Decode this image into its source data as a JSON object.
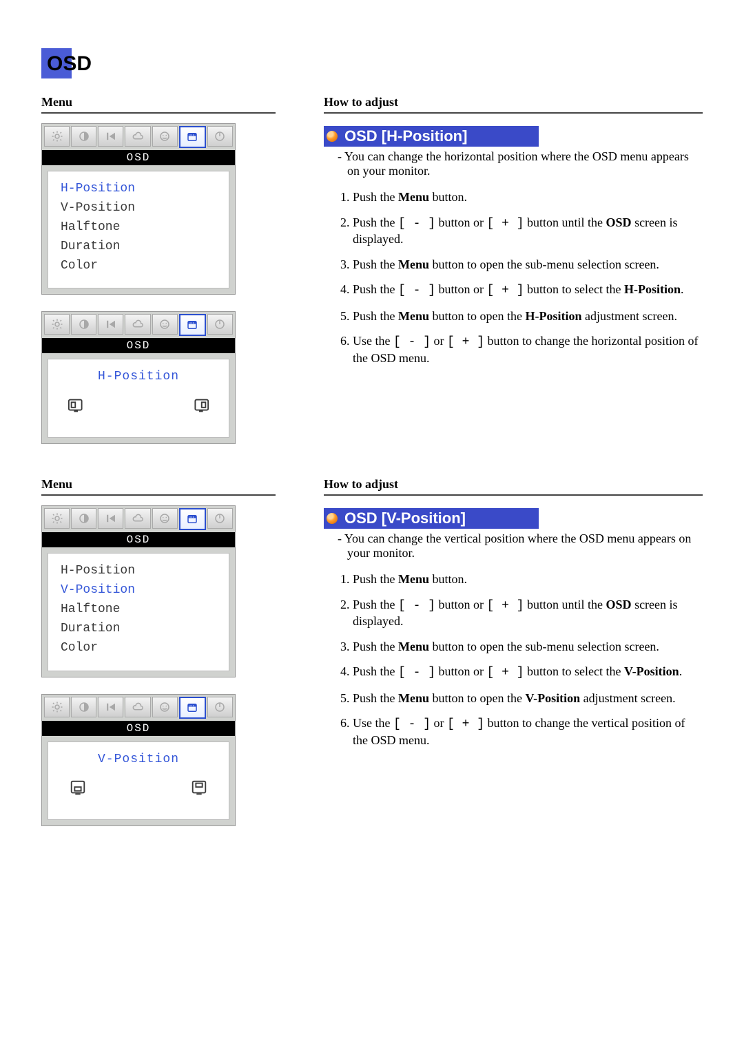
{
  "title": "OSD",
  "columns": {
    "left": "Menu",
    "right": "How to adjust"
  },
  "osd_menu": {
    "header_label": "OSD",
    "items": [
      "H-Position",
      "V-Position",
      "Halftone",
      "Duration",
      "Color"
    ]
  },
  "sections": [
    {
      "heading": "OSD [H-Position]",
      "sub_label": "H-Position",
      "selected_index": 0,
      "desc": "- You can change the horizontal position where the OSD menu appears on your monitor.",
      "steps": [
        [
          {
            "t": "Push the "
          },
          {
            "b": "Menu"
          },
          {
            "t": " button."
          }
        ],
        [
          {
            "t": "Push the "
          },
          {
            "m": "[ - ]"
          },
          {
            "t": " button or "
          },
          {
            "m": "[ + ]"
          },
          {
            "t": " button until the "
          },
          {
            "b": "OSD"
          },
          {
            "t": " screen is displayed."
          }
        ],
        [
          {
            "t": "Push the "
          },
          {
            "b": "Menu"
          },
          {
            "t": " button to open the sub-menu selection screen."
          }
        ],
        [
          {
            "t": "Push the "
          },
          {
            "m": "[ - ]"
          },
          {
            "t": " button or "
          },
          {
            "m": "[ + ]"
          },
          {
            "t": " button to select the "
          },
          {
            "b": "H-Position"
          },
          {
            "t": "."
          }
        ],
        [
          {
            "t": "Push the "
          },
          {
            "b": "Menu"
          },
          {
            "t": " button to open the "
          },
          {
            "b": "H-Position"
          },
          {
            "t": " adjustment screen."
          }
        ],
        [
          {
            "t": "Use the "
          },
          {
            "m": "[ - ]"
          },
          {
            "t": " or "
          },
          {
            "m": "[ + ]"
          },
          {
            "t": " button to change the horizontal position of the OSD menu."
          }
        ]
      ]
    },
    {
      "heading": "OSD [V-Position]",
      "sub_label": "V-Position",
      "selected_index": 1,
      "desc": "- You can change the vertical position where the OSD menu appears on your monitor.",
      "steps": [
        [
          {
            "t": "Push the "
          },
          {
            "b": "Menu"
          },
          {
            "t": " button."
          }
        ],
        [
          {
            "t": "Push the "
          },
          {
            "m": "[ - ]"
          },
          {
            "t": " button or "
          },
          {
            "m": "[ + ]"
          },
          {
            "t": " button until the "
          },
          {
            "b": "OSD"
          },
          {
            "t": " screen is displayed."
          }
        ],
        [
          {
            "t": "Push the "
          },
          {
            "b": "Menu"
          },
          {
            "t": " button to open the sub-menu selection screen."
          }
        ],
        [
          {
            "t": "Push the "
          },
          {
            "m": "[ - ]"
          },
          {
            "t": " button or "
          },
          {
            "m": "[ + ]"
          },
          {
            "t": " button to select the "
          },
          {
            "b": "V-Position"
          },
          {
            "t": "."
          }
        ],
        [
          {
            "t": "Push the "
          },
          {
            "b": "Menu"
          },
          {
            "t": " button to open the "
          },
          {
            "b": "V-Position"
          },
          {
            "t": " adjustment screen."
          }
        ],
        [
          {
            "t": "Use the "
          },
          {
            "m": "[ - ]"
          },
          {
            "t": " or "
          },
          {
            "m": "[ + ]"
          },
          {
            "t": " button to change the vertical position of the OSD menu."
          }
        ]
      ]
    }
  ]
}
